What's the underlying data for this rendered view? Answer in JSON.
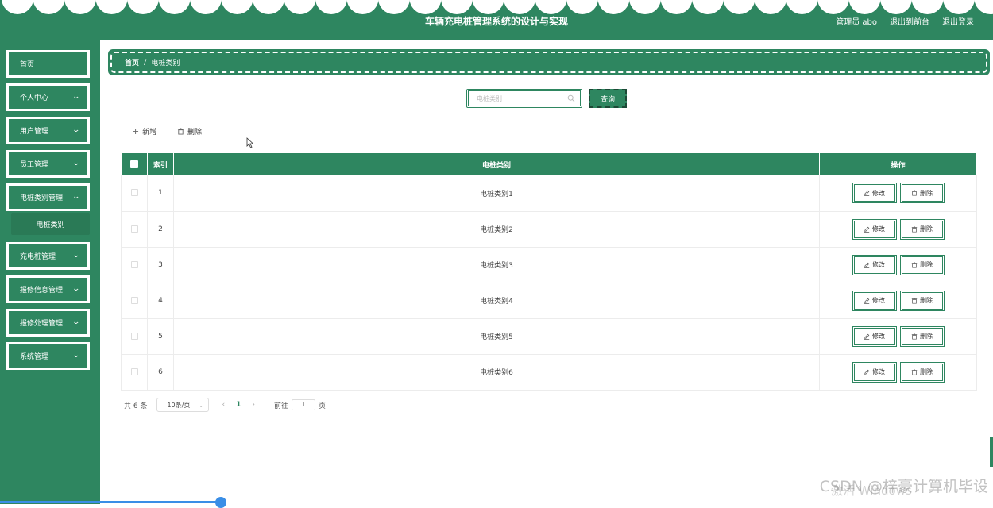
{
  "header": {
    "title": "车辆充电桩管理系统的设计与实现",
    "admin": "管理员 abo",
    "to_front": "退出到前台",
    "logout": "退出登录"
  },
  "sidebar": {
    "items": [
      {
        "label": "首页",
        "has_chevron": false
      },
      {
        "label": "个人中心",
        "has_chevron": true
      },
      {
        "label": "用户管理",
        "has_chevron": true
      },
      {
        "label": "员工管理",
        "has_chevron": true
      },
      {
        "label": "电桩类别管理",
        "has_chevron": true
      },
      {
        "label": "充电桩管理",
        "has_chevron": true
      },
      {
        "label": "报修信息管理",
        "has_chevron": true
      },
      {
        "label": "报修处理管理",
        "has_chevron": true
      },
      {
        "label": "系统管理",
        "has_chevron": true
      }
    ],
    "subitem": "电桩类别"
  },
  "breadcrumb": {
    "home": "首页",
    "separator": "/",
    "current": "电桩类别"
  },
  "search": {
    "placeholder": "电桩类别",
    "button": "查询"
  },
  "actions": {
    "add": "新增",
    "delete": "删除"
  },
  "table": {
    "headers": [
      "",
      "索引",
      "电桩类别",
      "操作"
    ],
    "rows": [
      {
        "index": "1",
        "category": "电桩类别1"
      },
      {
        "index": "2",
        "category": "电桩类别2"
      },
      {
        "index": "3",
        "category": "电桩类别3"
      },
      {
        "index": "4",
        "category": "电桩类别4"
      },
      {
        "index": "5",
        "category": "电桩类别5"
      },
      {
        "index": "6",
        "category": "电桩类别6"
      }
    ],
    "edit_label": "修改",
    "delete_label": "删除"
  },
  "pagination": {
    "total": "共 6 条",
    "page_size": "10条/页",
    "current_page": "1",
    "goto": "前往",
    "goto_value": "1",
    "page_suffix": "页"
  },
  "watermark": "CSDN @梓豪计算机毕设",
  "watermark2": "激活 Windows",
  "colors": {
    "primary": "#2e8660",
    "scrollbar": "#3a8ee6"
  }
}
